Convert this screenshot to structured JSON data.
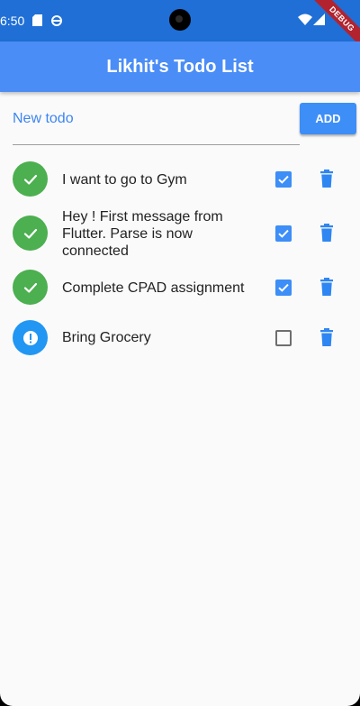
{
  "status_bar": {
    "time": "6:50",
    "debug_label": "DEBUG"
  },
  "app_bar": {
    "title": "Likhit's Todo List"
  },
  "new_todo": {
    "placeholder": "New todo",
    "value": "",
    "add_label": "ADD"
  },
  "todos": [
    {
      "title": "I want to go to Gym",
      "done": true
    },
    {
      "title": "Hey ! First message from Flutter. Parse is now connected",
      "done": true
    },
    {
      "title": "Complete CPAD assignment",
      "done": true
    },
    {
      "title": "Bring Grocery",
      "done": false
    }
  ],
  "colors": {
    "app_bar": "#4a8df6",
    "status_bar": "#1f6fd6",
    "done": "#4caf50",
    "pending": "#2196f3",
    "accent": "#3d8ef7"
  },
  "icons": {
    "done": "check-icon",
    "pending": "error-icon",
    "delete": "trash-icon"
  }
}
